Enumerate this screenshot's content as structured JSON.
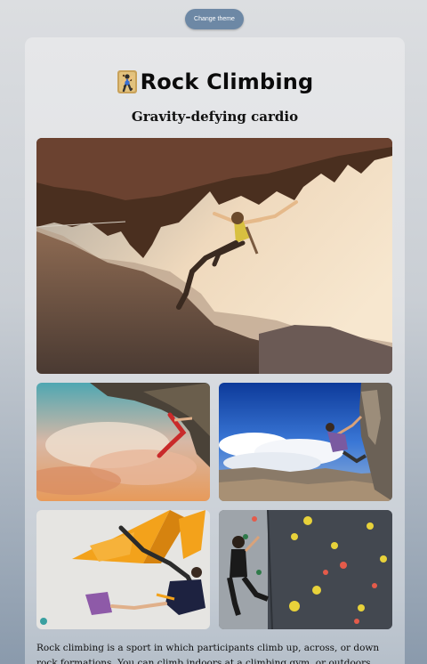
{
  "theme_button": {
    "label": "Change theme"
  },
  "header": {
    "icon": "person-climbing-icon",
    "title": "Rock Climbing",
    "subtitle": "Gravity-defying cardio"
  },
  "photos": {
    "hero": "climber-hanging-under-overhang-photo",
    "gallery": [
      "climber-under-roof-at-sunset-photo",
      "climber-on-cliff-above-valley-photo",
      "indoor-bouldering-wall-photo",
      "indoor-climbing-gym-wall-photo"
    ]
  },
  "description": "Rock climbing is a sport in which participants climb up, across, or down rock formations. You can climb indoors at a climbing gym, or outdoors. The goal is to"
}
